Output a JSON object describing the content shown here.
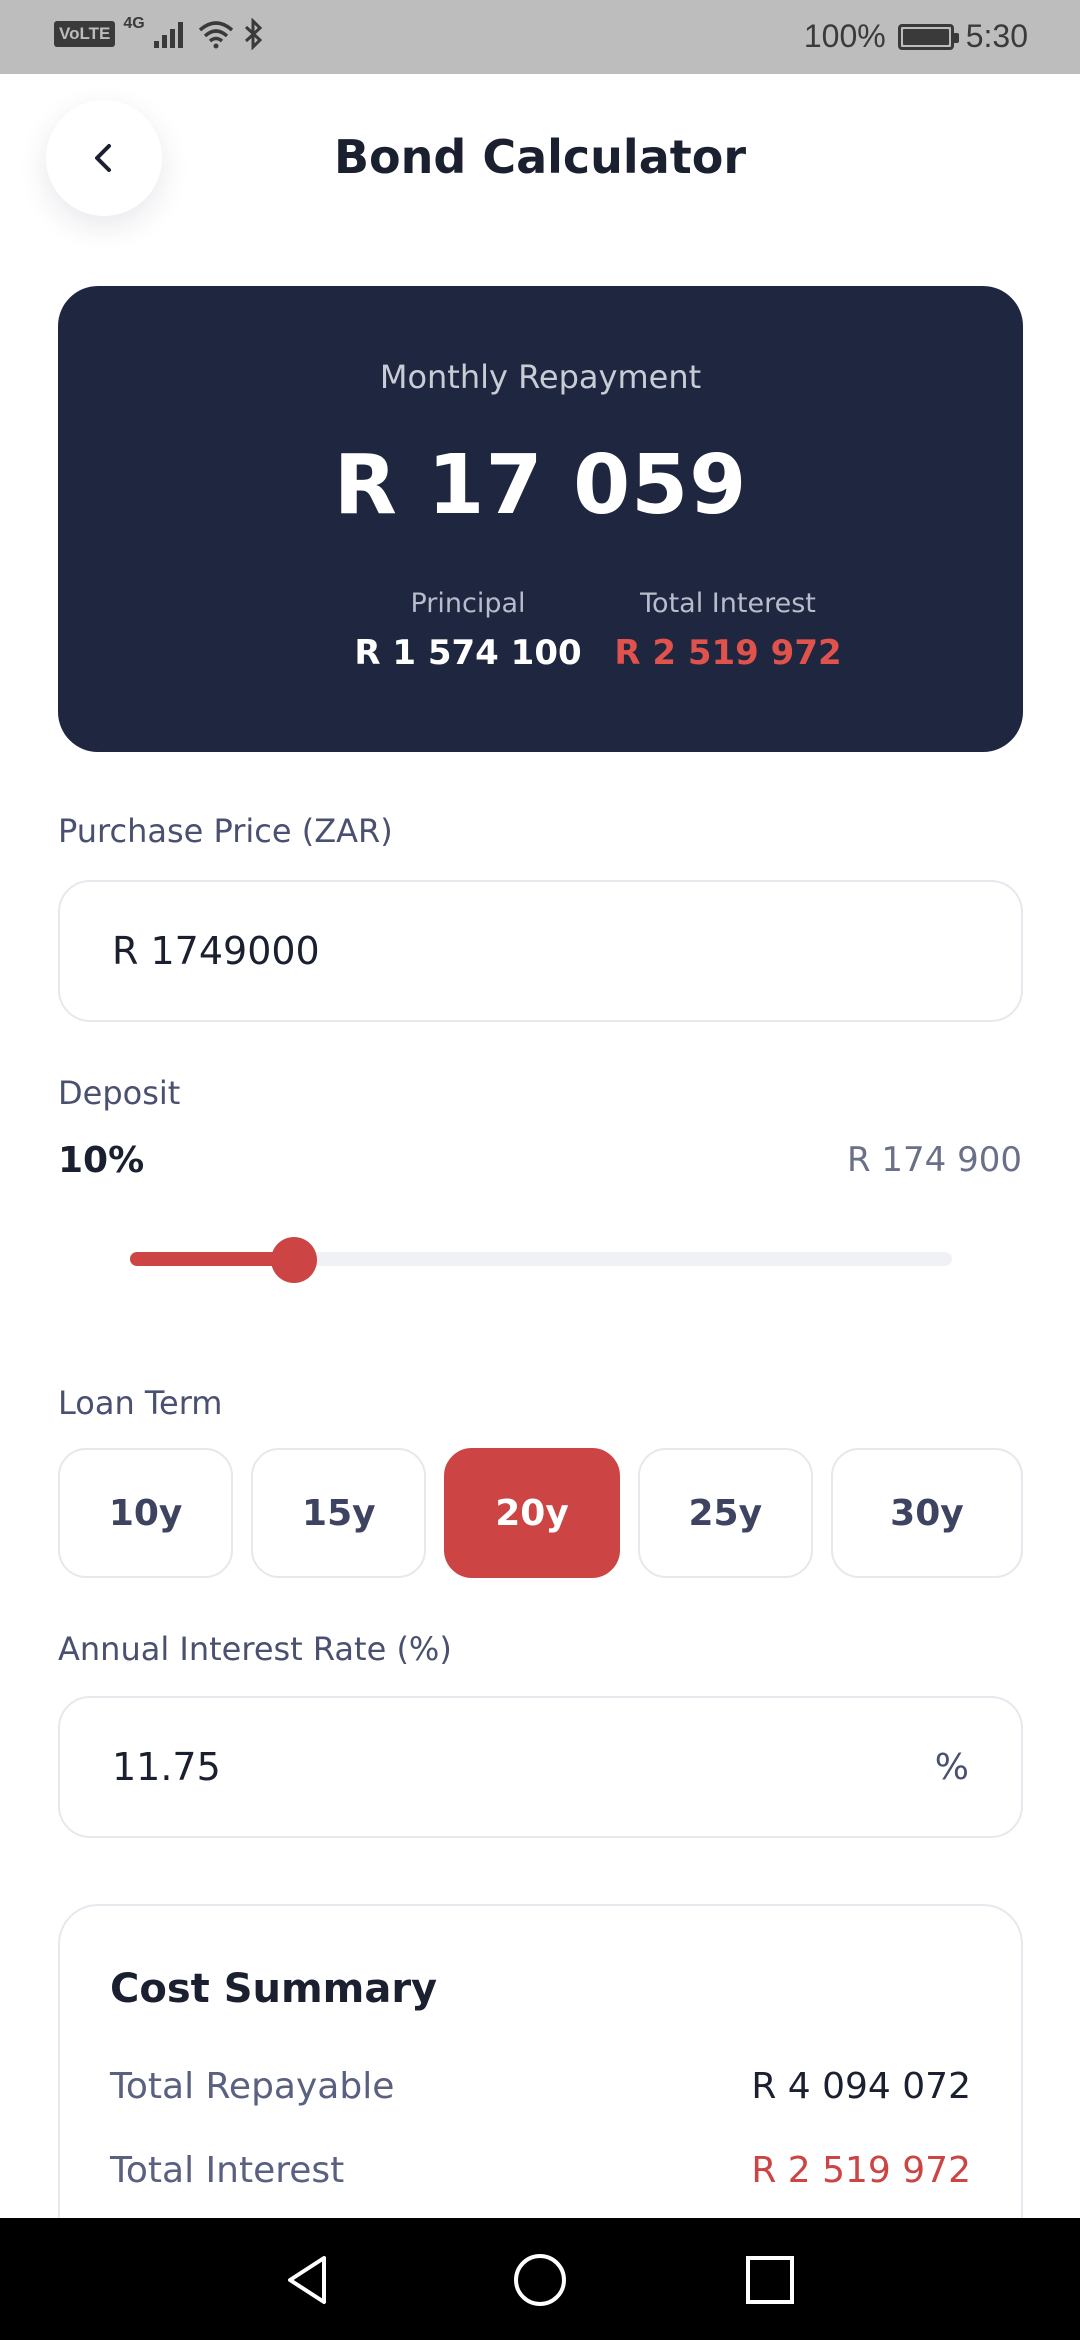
{
  "status_bar": {
    "volte": "VoLTE",
    "network": "4G",
    "battery_text": "100%",
    "battery_level": 1.0,
    "time": "5:30"
  },
  "header": {
    "title": "Bond Calculator",
    "back_icon": "chevron-left-icon"
  },
  "summary_hero": {
    "label": "Monthly Repayment",
    "amount": "R 17 059",
    "principal_label": "Principal",
    "principal_value": "R 1 574 100",
    "interest_label": "Total Interest",
    "interest_value": "R 2 519 972"
  },
  "purchase_price": {
    "label": "Purchase Price (ZAR)",
    "value": "R 1749000"
  },
  "deposit": {
    "label": "Deposit",
    "percent_text": "10%",
    "amount_text": "R 174 900",
    "slider_fraction": 0.2
  },
  "loan_term": {
    "label": "Loan Term",
    "options": [
      "10y",
      "15y",
      "20y",
      "25y",
      "30y"
    ],
    "selected": "20y"
  },
  "interest_rate": {
    "label": "Annual Interest Rate (%)",
    "value": "11.75",
    "suffix": "%"
  },
  "cost_summary": {
    "title": "Cost Summary",
    "rows": [
      {
        "label": "Total Repayable",
        "value": "R 4 094 072"
      },
      {
        "label": "Total Interest",
        "value": "R 2 519 972"
      }
    ]
  },
  "colors": {
    "accent": "#cc4444",
    "hero_bg": "#1f2740",
    "text_dark": "#1b2030"
  },
  "nav": {
    "back": "triangle-back-icon",
    "home": "circle-home-icon",
    "recents": "square-recents-icon"
  }
}
